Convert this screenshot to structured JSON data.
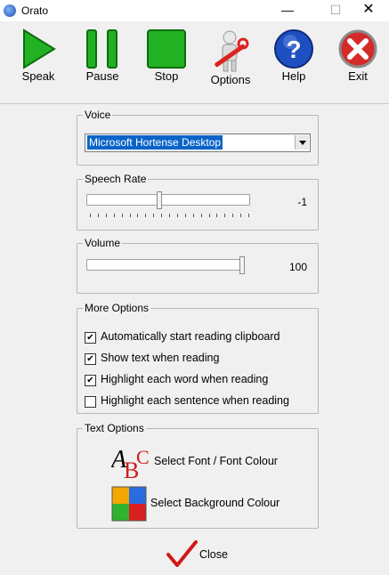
{
  "window": {
    "title": "Orato",
    "minimize": "—",
    "maximize": "☐",
    "close": "✕"
  },
  "toolbar": {
    "speak": "Speak",
    "pause": "Pause",
    "stop": "Stop",
    "options": "Options",
    "help": "Help",
    "exit": "Exit"
  },
  "voice": {
    "title": "Voice",
    "selected": "Microsoft Hortense Desktop"
  },
  "speech_rate": {
    "title": "Speech Rate",
    "value": "-1",
    "level": 0.45
  },
  "volume": {
    "title": "Volume",
    "value": "100",
    "level": 1.0
  },
  "more_options": {
    "title": "More Options",
    "items": [
      {
        "label": "Automatically start reading clipboard",
        "checked": true
      },
      {
        "label": "Show text when reading",
        "checked": true
      },
      {
        "label": "Highlight each word when reading",
        "checked": true
      },
      {
        "label": "Highlight each sentence when reading",
        "checked": false
      }
    ]
  },
  "text_options": {
    "title": "Text Options",
    "font_button": "Select Font / Font Colour",
    "background_button": "Select Background Colour"
  },
  "close_button": "Close",
  "colors": {
    "selection": "#0a64c8",
    "green": "#1fa81f",
    "help_blue": "#1e4fc2",
    "exit_red": "#d42a2a"
  }
}
